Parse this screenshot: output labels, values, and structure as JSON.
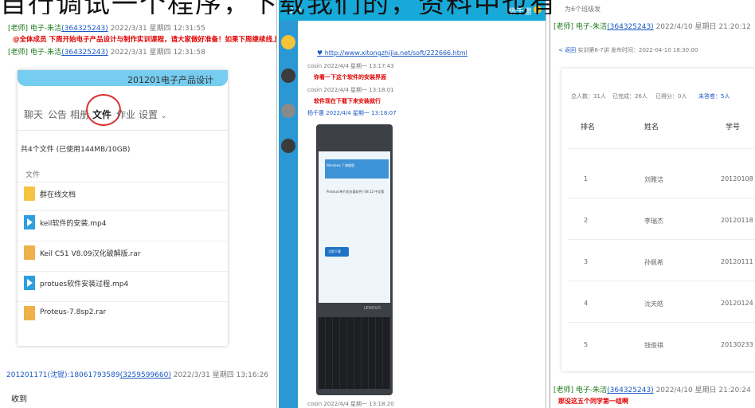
{
  "title_overlay": "自行调试一个程序，下载我们的，资料中也有",
  "panel1": {
    "msg1_header": "[老师] 电子-朱洁",
    "msg1_id": "(364325243)",
    "msg1_time": "2022/3/31 星期四 12:31:55",
    "msg1_text": "@全体成员 下周开始电子产品设计与制作实训课程，请大家做好准备！如果下周继续线上上课，请大家自备电脑安装软件！",
    "msg2_header": "[老师] 电子-朱洁",
    "msg2_id": "(364325243)",
    "msg2_time": "2022/3/31 星期四 12:31:58",
    "banner": "201201电子产品设计",
    "tabs": [
      "聊天",
      "公告",
      "相册",
      "文件",
      "作业",
      "设置"
    ],
    "quota": "共4个文件 (已使用144MB/10GB)",
    "file_header": "文件",
    "files": [
      {
        "name": "群在线文档",
        "type": "folder"
      },
      {
        "name": "keil软件的安装.mp4",
        "type": "video"
      },
      {
        "name": "Keil C51 V8.09汉化破解版.rar",
        "type": "rar"
      },
      {
        "name": "protues软件安装过程.mp4",
        "type": "video"
      },
      {
        "name": "Proteus-7.8sp2.rar",
        "type": "rar"
      }
    ],
    "msg3_header": "201201171(沈锟):18061793589",
    "msg3_id": "(3259599660)",
    "msg3_time": "2022/3/31 星期四 13:16:26",
    "msg3_text": "收到"
  },
  "panel2": {
    "search_hint": "Q",
    "add": "+",
    "user_name": "杨千惠",
    "link": "http://www.xitongzhijia.net/soft/222666.html",
    "m1_sender": "cosin 2022/4/4 星期一 13:17:43",
    "m1_text": "你看一下这个软件的安装界面",
    "m2_sender": "cosin 2022/4/4 星期一 13:18:01",
    "m2_text": "软件现在下载下来安装就行",
    "m3_sender": "杨千惠 2022/4/4 星期一 13:18:07",
    "photo_line1": "Windows 7 旗舰版",
    "photo_line2": "Proteus(单片机仿真软件) V8.12 中文版",
    "photo_btn": "立即下载",
    "photo_brand": "LENOVO",
    "m4_sender": "cosin 2022/4/4 星期一 13:18:20"
  },
  "panel3": {
    "top_partial": "为6个班级发",
    "msg1_header": "[老师] 电子-朱洁",
    "msg1_id": "(364325243)",
    "msg1_time": "2022/4/10 星期日 21:20:12",
    "back": "< 返回",
    "task": "实训第6-7讲",
    "publish": "发布时间：2022-04-10 18:30:00",
    "stats": [
      "总人数：31人",
      "已完成：26人",
      "已得分：0人",
      "未答卷：5人"
    ],
    "col_rank": "排名",
    "col_name": "姓名",
    "col_id": "学号",
    "rows": [
      {
        "rank": "1",
        "name": "刘雅洁",
        "id": "20120108"
      },
      {
        "rank": "2",
        "name": "李瑞杰",
        "id": "20120118"
      },
      {
        "rank": "3",
        "name": "孙佩希",
        "id": "20120111"
      },
      {
        "rank": "4",
        "name": "沈天皓",
        "id": "20120124"
      },
      {
        "rank": "5",
        "name": "钱俊祺",
        "id": "20130233"
      }
    ],
    "msg2_header": "[老师] 电子-朱洁",
    "msg2_id": "(364325243)",
    "msg2_time": "2022/4/10 星期日 21:20:24",
    "msg2_text": "那没这五个同学第一组啊"
  }
}
